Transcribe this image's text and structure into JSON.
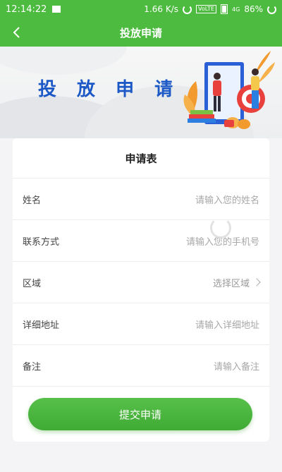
{
  "status_bar": {
    "time": "12:14:22",
    "speed": "1.66 K/s",
    "network_badge": "VoLTE",
    "signal_label": "4G",
    "battery": "86%"
  },
  "navbar": {
    "title": "投放申请"
  },
  "banner": {
    "heading": "投 放 申 请"
  },
  "form": {
    "title": "申请表",
    "fields": [
      {
        "label": "姓名",
        "placeholder": "请输入您的姓名",
        "type": "text"
      },
      {
        "label": "联系方式",
        "placeholder": "请输入您的手机号",
        "type": "text"
      },
      {
        "label": "区域",
        "placeholder": "选择区域",
        "type": "select"
      },
      {
        "label": "详细地址",
        "placeholder": "请输入详细地址",
        "type": "text"
      },
      {
        "label": "备注",
        "placeholder": "请输入备注",
        "type": "text"
      }
    ],
    "submit_label": "提交申请"
  },
  "colors": {
    "brand_green": "#4dbb3f",
    "heading_blue": "#1c58c6"
  }
}
